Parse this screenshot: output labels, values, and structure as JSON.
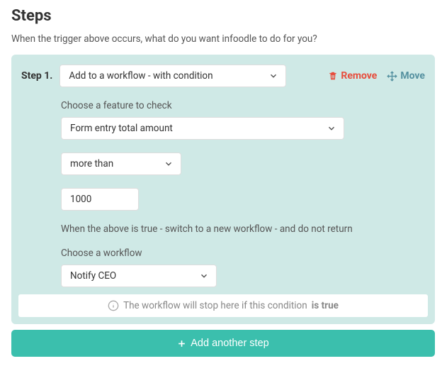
{
  "title": "Steps",
  "subtitle": "When the trigger above occurs, what do you want infoodle to do for you?",
  "step": {
    "label": "Step 1.",
    "action_type": "Add to a workflow - with condition",
    "remove_label": "Remove",
    "move_label": "Move",
    "feature_label": "Choose a feature to check",
    "feature_value": "Form entry total amount",
    "comparator_value": "more than",
    "amount_value": "1000",
    "switch_helper": "When the above is true - switch to a new workflow - and do not return",
    "workflow_label": "Choose a workflow",
    "workflow_value": "Notify CEO",
    "notice_pre": "The workflow will stop here if this condition",
    "notice_bold": "is true"
  },
  "add_button": "Add another step"
}
